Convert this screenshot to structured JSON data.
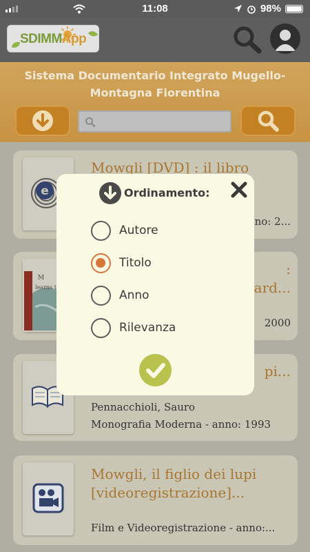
{
  "status_bar": {
    "time": "11:08",
    "battery": "98%",
    "battery_fraction": 0.98
  },
  "app": {
    "logo_text_left": "SDIMM",
    "logo_text_right": "App",
    "library_name": "Sistema Documentario Integrato Mugello-Montagna Fiorentina"
  },
  "search": {
    "placeholder": "",
    "value": ""
  },
  "results": [
    {
      "title": "Mowgli [DVD] : il libro",
      "line1": "",
      "line2": "anno: 2...",
      "thumb": "e-resource-icon"
    },
    {
      "title": ":\nard...",
      "line1": "",
      "line2": "2000",
      "thumb": "book-cover-image"
    },
    {
      "title": "pi...",
      "line1": "Pennacchioli, Sauro",
      "line2": "Monografia Moderna - anno: 1993",
      "thumb": "open-book-icon"
    },
    {
      "title": "Mowgli, il figlio dei lupi\n[videoregistrazione]...",
      "line1": "",
      "line2": "Film e Videoregistrazione - anno:...",
      "thumb": "film-projector-icon"
    }
  ],
  "sort_dialog": {
    "title": "Ordinamento:",
    "options": [
      {
        "label": "Autore",
        "selected": false
      },
      {
        "label": "Titolo",
        "selected": true
      },
      {
        "label": "Anno",
        "selected": false
      },
      {
        "label": "Rilevanza",
        "selected": false
      }
    ]
  },
  "colors": {
    "accent_orange": "#c38123",
    "radio_selected": "#d9773a",
    "confirm_green": "#b9c24d",
    "title_gold": "#a87630"
  }
}
